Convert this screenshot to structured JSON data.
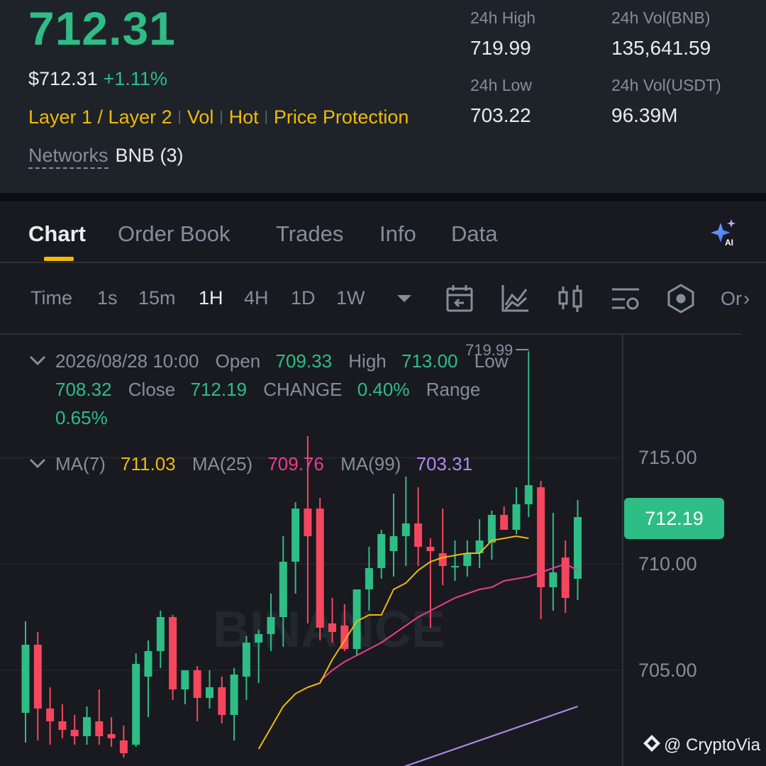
{
  "header": {
    "price": "712.31",
    "price_usd": "$712.31",
    "change_pct": "+1.11%",
    "tags": [
      "Layer 1 / Layer 2",
      "Vol",
      "Hot",
      "Price Protection"
    ],
    "networks_label": "Networks",
    "networks_value": "BNB (3)",
    "stats": {
      "high_label": "24h High",
      "high_value": "719.99",
      "low_label": "24h Low",
      "low_value": "703.22",
      "vol_bnb_label": "24h Vol(BNB)",
      "vol_bnb_value": "135,641.59",
      "vol_usdt_label": "24h Vol(USDT)",
      "vol_usdt_value": "96.39M"
    }
  },
  "tabs": [
    "Chart",
    "Order Book",
    "Trades",
    "Info",
    "Data"
  ],
  "active_tab": "Chart",
  "intervals": [
    "Time",
    "1s",
    "15m",
    "1H",
    "4H",
    "1D",
    "1W"
  ],
  "active_interval": "1H",
  "toolbar_icons": [
    "interval-dropdown-icon",
    "date-range-icon",
    "indicator-icon",
    "candle-type-icon",
    "settings-icon",
    "depth-icon"
  ],
  "toolbar_more": "Or",
  "ohlc": {
    "datetime": "2026/08/28 10:00",
    "open_label": "Open",
    "open": "709.33",
    "high_label": "High",
    "high": "713.00",
    "low_label": "Low",
    "low": "708.32",
    "close_label": "Close",
    "close": "712.19",
    "change_label": "CHANGE",
    "change": "0.40%",
    "range_label": "Range",
    "range": "0.65%"
  },
  "ma": {
    "ma7_label": "MA(7)",
    "ma7": "711.03",
    "ma25_label": "MA(25)",
    "ma25": "709.76",
    "ma99_label": "MA(99)",
    "ma99": "703.31"
  },
  "chart_data": {
    "type": "candlestick",
    "max_marker": "719.99",
    "last_price": "712.19",
    "y_ticks": [
      "715.00",
      "710.00",
      "705.00"
    ],
    "ylim": [
      701.3,
      716.3
    ],
    "candles": [
      {
        "o": 703.0,
        "h": 707.3,
        "l": 701.6,
        "c": 706.2
      },
      {
        "o": 706.2,
        "h": 706.8,
        "l": 701.7,
        "c": 703.2
      },
      {
        "o": 703.2,
        "h": 704.2,
        "l": 701.5,
        "c": 702.6
      },
      {
        "o": 702.6,
        "h": 703.4,
        "l": 701.8,
        "c": 702.2
      },
      {
        "o": 702.2,
        "h": 702.9,
        "l": 701.5,
        "c": 701.9
      },
      {
        "o": 701.9,
        "h": 703.3,
        "l": 701.5,
        "c": 702.8
      },
      {
        "o": 702.6,
        "h": 704.1,
        "l": 701.5,
        "c": 701.9
      },
      {
        "o": 702.0,
        "h": 702.8,
        "l": 701.4,
        "c": 701.8
      },
      {
        "o": 701.7,
        "h": 702.4,
        "l": 700.9,
        "c": 701.1
      },
      {
        "o": 701.5,
        "h": 705.8,
        "l": 701.4,
        "c": 705.3
      },
      {
        "o": 704.7,
        "h": 706.4,
        "l": 702.8,
        "c": 705.9
      },
      {
        "o": 705.9,
        "h": 707.8,
        "l": 705.1,
        "c": 707.5
      },
      {
        "o": 707.5,
        "h": 707.6,
        "l": 703.6,
        "c": 704.1
      },
      {
        "o": 704.1,
        "h": 705.0,
        "l": 703.4,
        "c": 705.0
      },
      {
        "o": 705.0,
        "h": 705.2,
        "l": 702.6,
        "c": 703.7
      },
      {
        "o": 703.7,
        "h": 705.0,
        "l": 703.2,
        "c": 704.2
      },
      {
        "o": 704.2,
        "h": 704.7,
        "l": 702.5,
        "c": 702.9
      },
      {
        "o": 702.9,
        "h": 705.1,
        "l": 701.7,
        "c": 704.8
      },
      {
        "o": 704.7,
        "h": 706.6,
        "l": 703.6,
        "c": 706.3
      },
      {
        "o": 706.3,
        "h": 706.9,
        "l": 704.4,
        "c": 706.7
      },
      {
        "o": 706.7,
        "h": 708.6,
        "l": 705.9,
        "c": 707.5
      },
      {
        "o": 707.5,
        "h": 711.3,
        "l": 706.1,
        "c": 710.1
      },
      {
        "o": 710.1,
        "h": 712.9,
        "l": 708.6,
        "c": 712.6
      },
      {
        "o": 712.6,
        "h": 716.0,
        "l": 707.2,
        "c": 711.3
      },
      {
        "o": 712.6,
        "h": 713.1,
        "l": 706.4,
        "c": 707.0
      },
      {
        "o": 707.2,
        "h": 708.4,
        "l": 706.3,
        "c": 706.8
      },
      {
        "o": 707.1,
        "h": 708.1,
        "l": 705.9,
        "c": 706.0
      },
      {
        "o": 706.0,
        "h": 708.8,
        "l": 705.7,
        "c": 708.8
      },
      {
        "o": 708.8,
        "h": 710.8,
        "l": 707.8,
        "c": 709.8
      },
      {
        "o": 709.8,
        "h": 711.6,
        "l": 709.3,
        "c": 711.4
      },
      {
        "o": 710.6,
        "h": 713.3,
        "l": 709.4,
        "c": 711.3
      },
      {
        "o": 711.3,
        "h": 714.1,
        "l": 709.9,
        "c": 711.9
      },
      {
        "o": 711.9,
        "h": 713.6,
        "l": 709.9,
        "c": 710.8
      },
      {
        "o": 710.8,
        "h": 711.2,
        "l": 707.0,
        "c": 710.6
      },
      {
        "o": 710.5,
        "h": 712.6,
        "l": 709.0,
        "c": 709.9
      },
      {
        "o": 709.9,
        "h": 711.1,
        "l": 709.2,
        "c": 709.9
      },
      {
        "o": 709.9,
        "h": 711.1,
        "l": 709.4,
        "c": 710.5
      },
      {
        "o": 710.5,
        "h": 712.1,
        "l": 709.8,
        "c": 711.1
      },
      {
        "o": 711.0,
        "h": 712.5,
        "l": 710.2,
        "c": 712.3
      },
      {
        "o": 712.3,
        "h": 712.7,
        "l": 711.6,
        "c": 711.6
      },
      {
        "o": 711.6,
        "h": 713.6,
        "l": 711.4,
        "c": 712.8
      },
      {
        "o": 712.8,
        "h": 719.99,
        "l": 712.2,
        "c": 713.7
      },
      {
        "o": 713.6,
        "h": 713.9,
        "l": 707.4,
        "c": 708.9
      },
      {
        "o": 708.9,
        "h": 712.4,
        "l": 707.8,
        "c": 709.6
      },
      {
        "o": 710.3,
        "h": 711.1,
        "l": 707.7,
        "c": 708.4
      },
      {
        "o": 709.3,
        "h": 713.0,
        "l": 708.3,
        "c": 712.2
      }
    ],
    "ma7": [
      null,
      null,
      null,
      null,
      null,
      null,
      701.3,
      702.3,
      703.3,
      703.9,
      704.2,
      704.4,
      705.5,
      706.4,
      707.3,
      707.6,
      707.6,
      708.8,
      709.1,
      709.7,
      710.1,
      710.3,
      710.4,
      710.5,
      710.5,
      711.1,
      711.2,
      711.3,
      711.2
    ],
    "ma25": [
      null,
      null,
      null,
      null,
      null,
      null,
      null,
      null,
      null,
      null,
      null,
      null,
      null,
      null,
      null,
      null,
      null,
      null,
      null,
      null,
      null,
      704.5,
      705.0,
      705.4,
      705.7,
      706.0,
      706.3,
      706.7,
      707.1,
      707.5,
      707.8,
      708.1,
      708.4,
      708.6,
      708.8,
      708.9,
      709.2,
      709.3,
      709.4,
      709.6,
      709.8,
      710.0,
      709.7
    ],
    "ma99": [
      700.3,
      700.5,
      700.7,
      700.9,
      701.1,
      701.3,
      701.5,
      701.7,
      701.9,
      702.1,
      702.3,
      702.5,
      702.7,
      702.9,
      703.1,
      703.3
    ]
  },
  "watermark": "BINANCE",
  "credit": "@ CryptoVia",
  "colors": {
    "up": "#2ebd85",
    "down": "#f6465d",
    "accent": "#f0b90b",
    "ma7": "#f0b90b",
    "ma25": "#e83e8c",
    "ma99": "#b28af0",
    "bg_panel": "#181a20",
    "bg_header": "#1e2329"
  }
}
